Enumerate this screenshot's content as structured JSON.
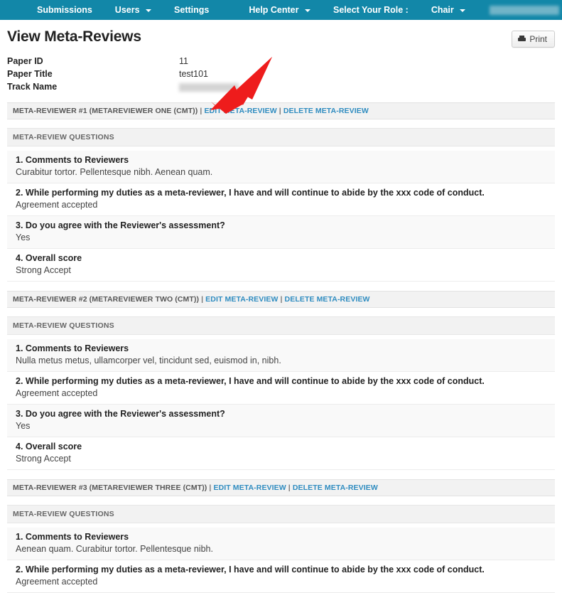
{
  "navbar": {
    "background_color": "#1287a8",
    "left_items": [
      {
        "label": "Submissions",
        "caret": false
      },
      {
        "label": "Users",
        "caret": true
      },
      {
        "label": "Settings",
        "caret": false
      }
    ],
    "center_items": [
      {
        "label": "Help Center",
        "caret": true
      },
      {
        "label": "Select Your Role :",
        "caret": false
      },
      {
        "label": "Chair",
        "caret": true
      }
    ],
    "redacted_items": [
      "redacted-user-name",
      "redacted-user-link"
    ]
  },
  "header": {
    "page_title": "View Meta-Reviews",
    "print_label": "Print"
  },
  "details": [
    {
      "label": "Paper ID",
      "value": "11",
      "redacted": false
    },
    {
      "label": "Paper Title",
      "value": "test101",
      "redacted": false
    },
    {
      "label": "Track Name",
      "value": "",
      "redacted": true
    }
  ],
  "labels": {
    "questions_bar": "META-REVIEW QUESTIONS",
    "edit_link": "EDIT META-REVIEW",
    "delete_link": "DELETE META-REVIEW",
    "separator": "|"
  },
  "link_color": "#2f8cc0",
  "reviewers": [
    {
      "header": "META-REVIEWER #1 (METAREVIEWER ONE (CMT))",
      "questions": [
        {
          "question": "1. Comments to Reviewers",
          "answer": "Curabitur tortor. Pellentesque nibh. Aenean quam."
        },
        {
          "question": "2. While performing my duties as a meta-reviewer, I have and will continue to abide by the xxx code of conduct.",
          "answer": "Agreement accepted"
        },
        {
          "question": "3. Do you agree with the Reviewer's assessment?",
          "answer": "Yes"
        },
        {
          "question": "4. Overall score",
          "answer": "Strong Accept"
        }
      ]
    },
    {
      "header": "META-REVIEWER #2 (METAREVIEWER TWO (CMT))",
      "questions": [
        {
          "question": "1. Comments to Reviewers",
          "answer": "Nulla metus metus, ullamcorper vel, tincidunt sed, euismod in, nibh."
        },
        {
          "question": "2. While performing my duties as a meta-reviewer, I have and will continue to abide by the xxx code of conduct.",
          "answer": "Agreement accepted"
        },
        {
          "question": "3. Do you agree with the Reviewer's assessment?",
          "answer": "Yes"
        },
        {
          "question": "4. Overall score",
          "answer": "Strong Accept"
        }
      ]
    },
    {
      "header": "META-REVIEWER #3 (METAREVIEWER THREE (CMT))",
      "questions": [
        {
          "question": "1. Comments to Reviewers",
          "answer": "Aenean quam. Curabitur tortor. Pellentesque nibh."
        },
        {
          "question": "2. While performing my duties as a meta-reviewer, I have and will continue to abide by the xxx code of conduct.",
          "answer": "Agreement accepted"
        }
      ]
    }
  ],
  "annotation": {
    "arrow_color": "#ee1c1c",
    "description": "red arrow pointing to EDIT META-REVIEW link of meta-reviewer #1"
  }
}
